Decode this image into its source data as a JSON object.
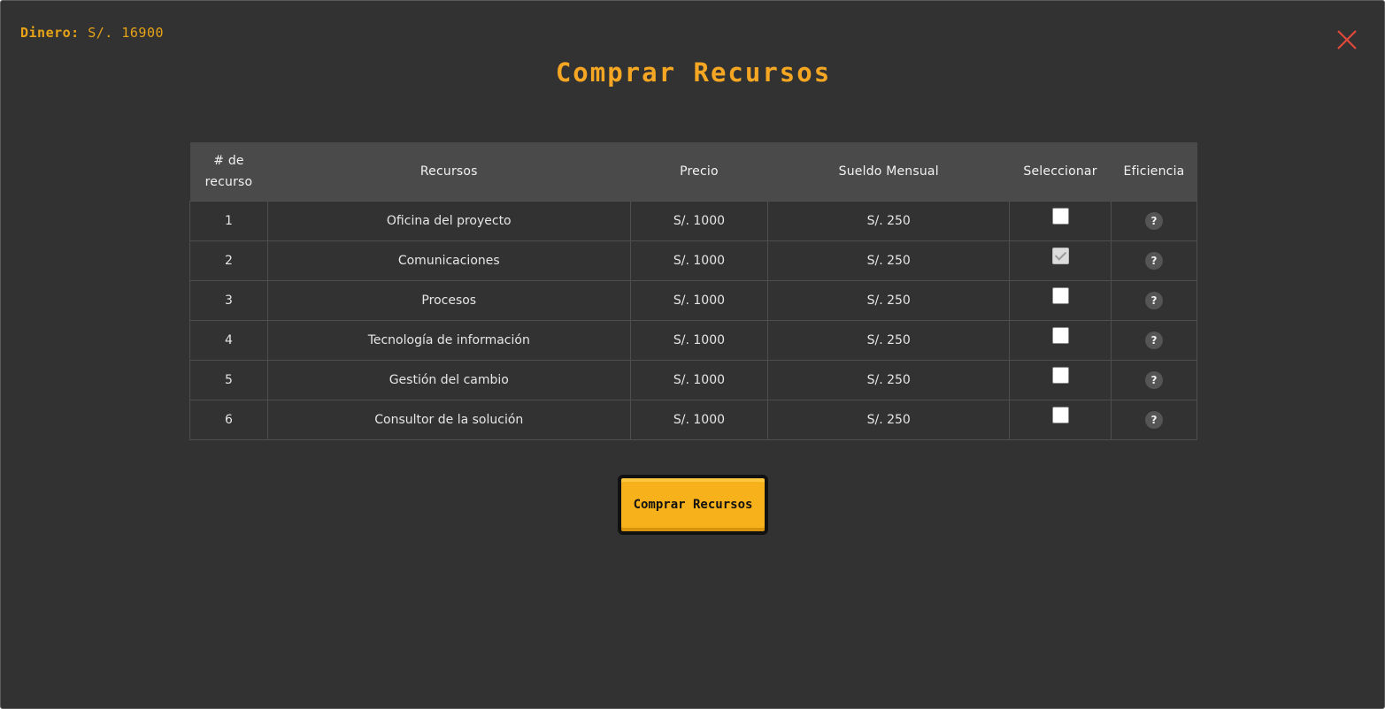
{
  "header": {
    "money_label": "Dinero:",
    "money_value": "S/. 16900",
    "title": "Comprar Recursos",
    "close_color": "#e04a3a"
  },
  "table": {
    "columns": [
      "# de recurso",
      "Recursos",
      "Precio",
      "Sueldo Mensual",
      "Seleccionar",
      "Eficiencia"
    ],
    "rows": [
      {
        "num": "1",
        "name": "Oficina del proyecto",
        "price": "S/. 1000",
        "salary": "S/. 250",
        "selected": false,
        "help": "?"
      },
      {
        "num": "2",
        "name": "Comunicaciones",
        "price": "S/. 1000",
        "salary": "S/. 250",
        "selected": true,
        "help": "?"
      },
      {
        "num": "3",
        "name": "Procesos",
        "price": "S/. 1000",
        "salary": "S/. 250",
        "selected": false,
        "help": "?"
      },
      {
        "num": "4",
        "name": "Tecnología de información",
        "price": "S/. 1000",
        "salary": "S/. 250",
        "selected": false,
        "help": "?"
      },
      {
        "num": "5",
        "name": "Gestión del cambio",
        "price": "S/. 1000",
        "salary": "S/. 250",
        "selected": false,
        "help": "?"
      },
      {
        "num": "6",
        "name": "Consultor de la solución",
        "price": "S/. 1000",
        "salary": "S/. 250",
        "selected": false,
        "help": "?"
      }
    ]
  },
  "actions": {
    "buy_label": "Comprar Recursos",
    "accent_color": "#f7b21b"
  }
}
